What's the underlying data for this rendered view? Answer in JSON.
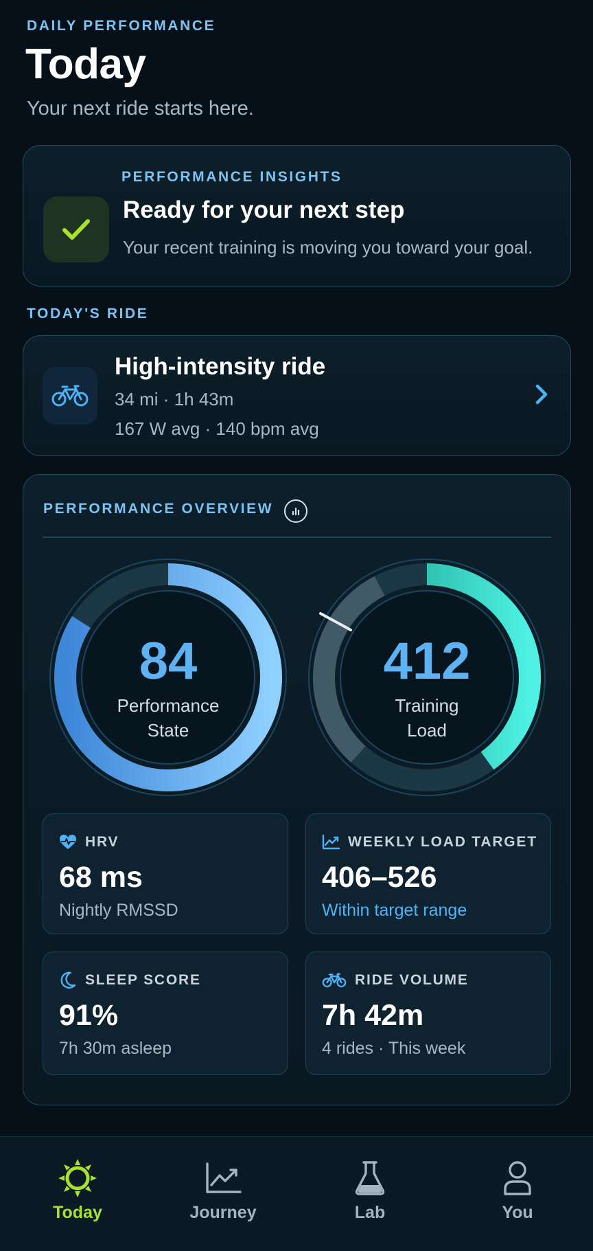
{
  "header": {
    "eyebrow": "DAILY PERFORMANCE",
    "title": "Today",
    "subtitle": "Your next ride starts here."
  },
  "insights": {
    "eyebrow": "PERFORMANCE INSIGHTS",
    "title": "Ready for your next step",
    "text": "Your recent training is moving you toward your goal.",
    "icon": "checkmark-icon"
  },
  "todays_ride": {
    "eyebrow": "TODAY'S RIDE",
    "title": "High-intensity ride",
    "meta_line1": "34 mi · 1h 43m",
    "meta_line2": "167 W avg · 140 bpm avg",
    "icon": "bicycle-icon"
  },
  "overview": {
    "eyebrow": "PERFORMANCE OVERVIEW",
    "info_icon": "chart-info-icon",
    "performance_state": {
      "value": "84",
      "label_line1": "Performance",
      "label_line2": "State",
      "fill_fraction": 0.84,
      "color": "#5eb2f2"
    },
    "training_load": {
      "value": "412",
      "label_line1": "Training",
      "label_line2": "Load",
      "fill_fraction": 0.4,
      "color": "#2fd6c4"
    },
    "stats": {
      "hrv": {
        "label": "HRV",
        "value": "68 ms",
        "sub": "Nightly RMSSD",
        "icon": "heart-pulse-icon"
      },
      "load_target": {
        "label": "WEEKLY LOAD TARGET",
        "value": "406–526",
        "sub": "Within target range",
        "icon": "trend-chart-icon"
      },
      "sleep": {
        "label": "SLEEP SCORE",
        "value": "91%",
        "sub": "7h 30m asleep",
        "icon": "moon-icon"
      },
      "ride_volume": {
        "label": "RIDE VOLUME",
        "value": "7h 42m",
        "sub": "4 rides · This week",
        "icon": "bicycle-icon"
      }
    }
  },
  "nav": {
    "items": [
      {
        "label": "Today",
        "icon": "sun-icon",
        "active": true
      },
      {
        "label": "Journey",
        "icon": "trend-chart-icon",
        "active": false
      },
      {
        "label": "Lab",
        "icon": "flask-icon",
        "active": false
      },
      {
        "label": "You",
        "icon": "person-icon",
        "active": false
      }
    ]
  },
  "colors": {
    "background": "#061019",
    "accent_blue": "#7cc3f2",
    "accent_green": "#a6e22e",
    "accent_teal": "#2fd6c4"
  }
}
